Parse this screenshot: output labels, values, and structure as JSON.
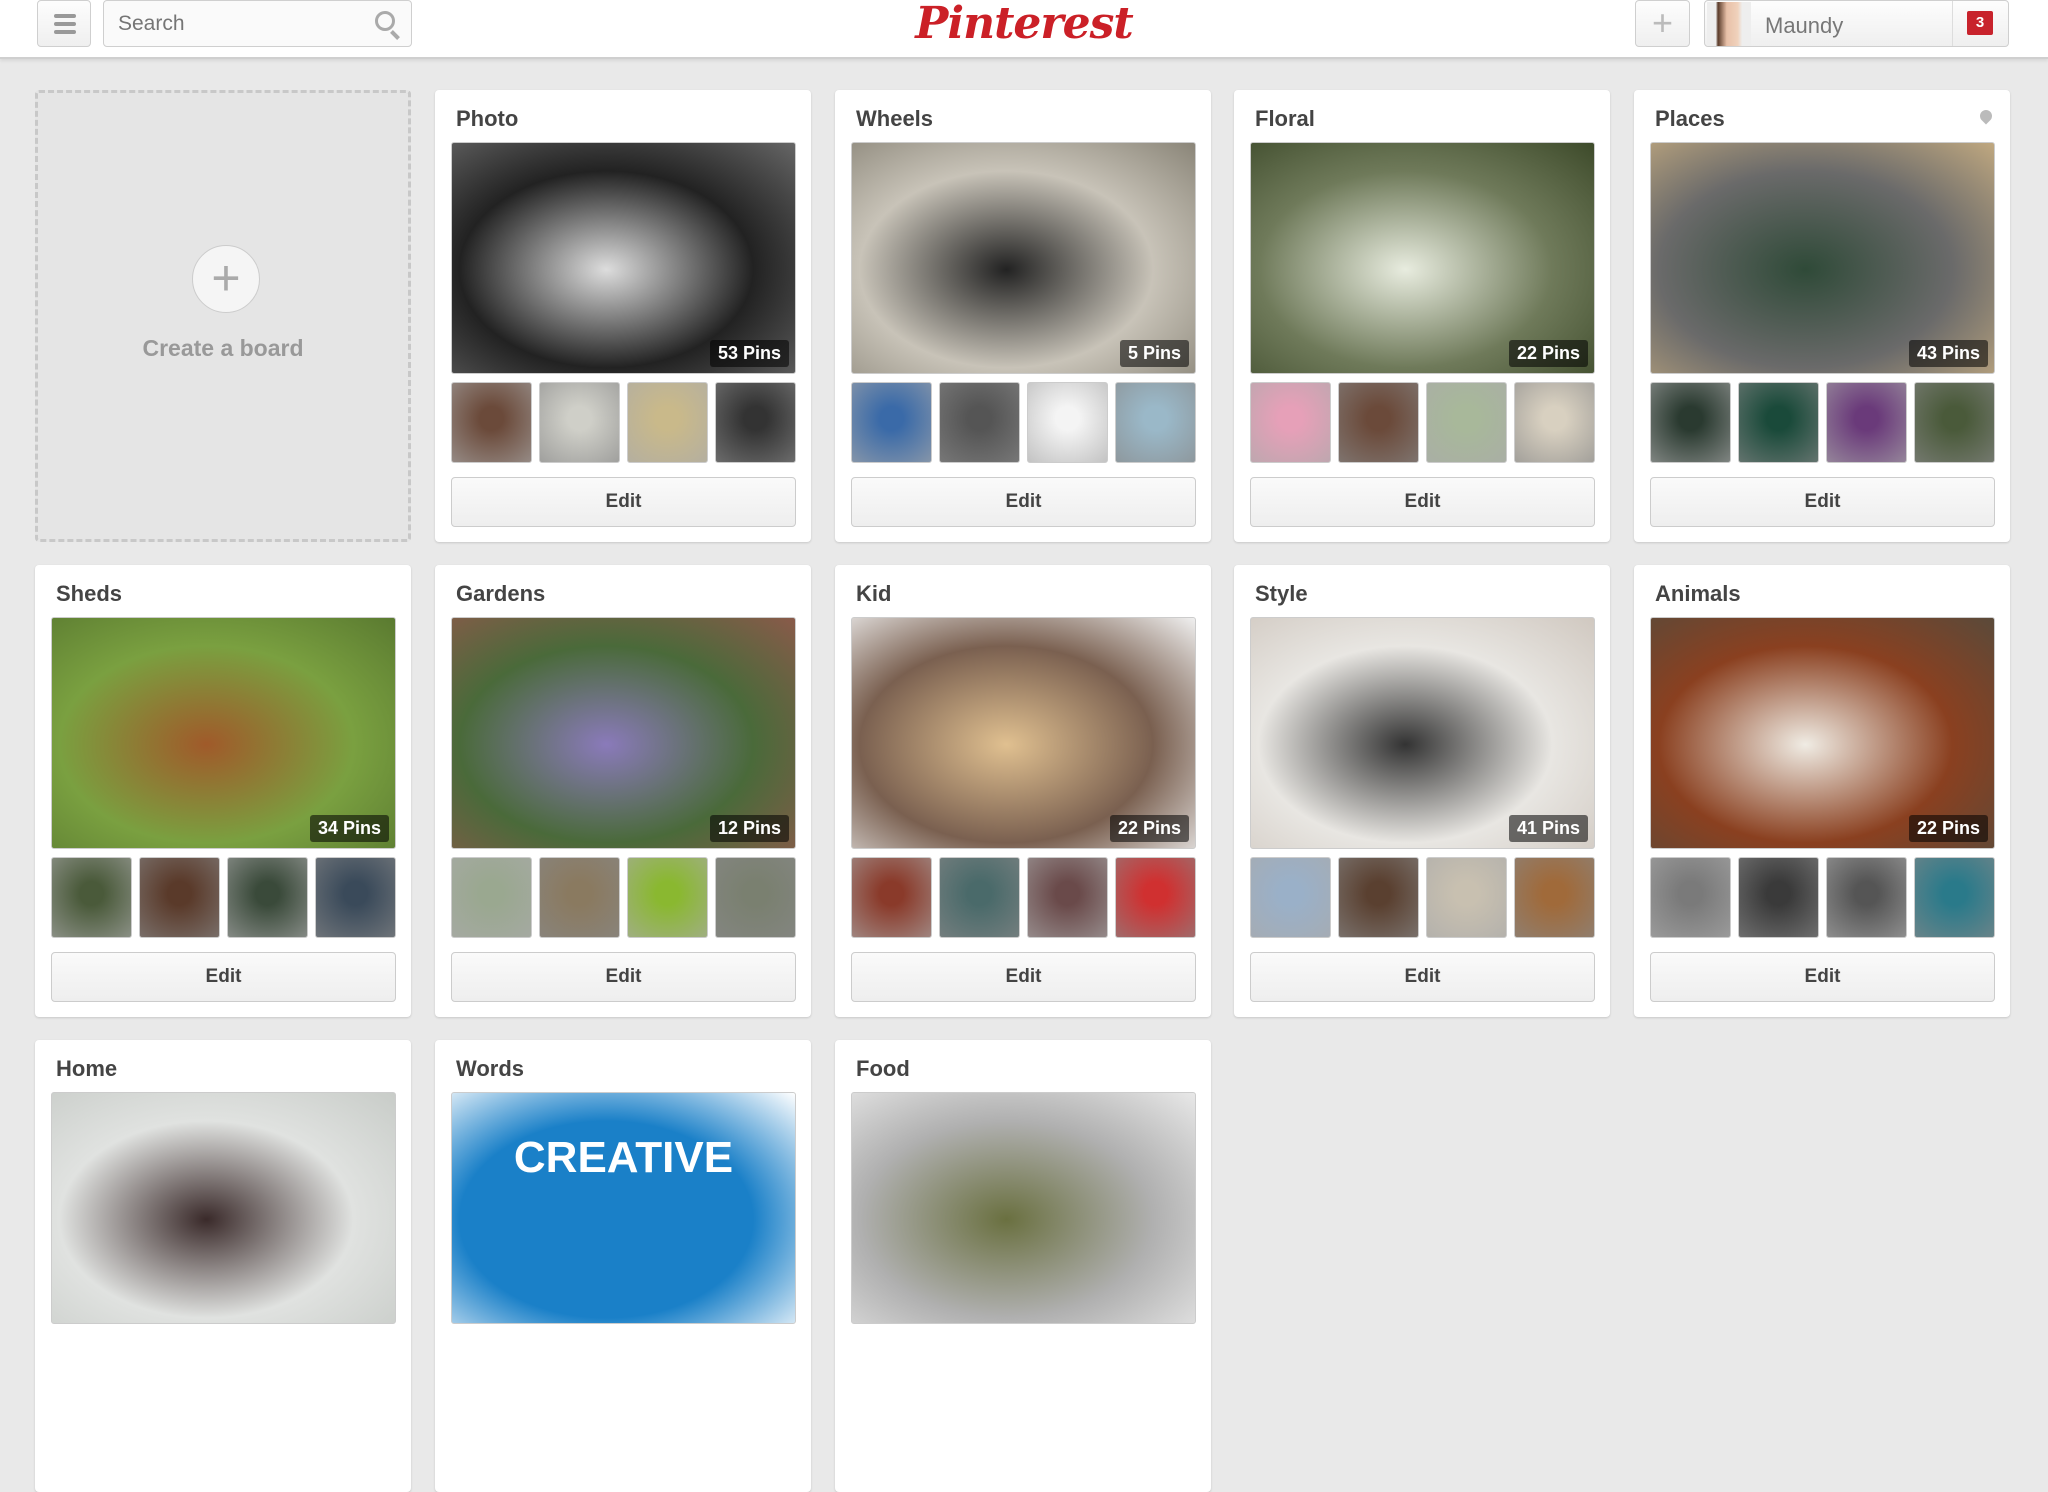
{
  "header": {
    "search_placeholder": "Search",
    "logo": "Pinterest",
    "user_name": "Maundy",
    "notification_count": "3",
    "brand_color": "#cb2027"
  },
  "create_board": {
    "label": "Create a board"
  },
  "edit_label": "Edit",
  "boards": [
    {
      "title": "Photo",
      "pins": "53 Pins",
      "cover": [
        "#222",
        "#ddd",
        "#666"
      ],
      "thumbs": [
        "#6b4a3a",
        "#cfcfc8",
        "#c9b98a",
        "#333"
      ]
    },
    {
      "title": "Wheels",
      "pins": "5 Pins",
      "cover": [
        "#c8c3b8",
        "#222",
        "#8a8578"
      ],
      "thumbs": [
        "#3a6aa8",
        "#555",
        "#f4f4f4",
        "#9ab8c8"
      ]
    },
    {
      "title": "Floral",
      "pins": "22 Pins",
      "cover": [
        "#6f7a5a",
        "#e8ecdf",
        "#3d4a2a"
      ],
      "thumbs": [
        "#e6a0b8",
        "#6b4a3a",
        "#a8b89a",
        "#d8d0c0"
      ]
    },
    {
      "title": "Places",
      "pins": "43 Pins",
      "cover": [
        "#6a6a6a",
        "#2f4a38",
        "#c0a880"
      ],
      "thumbs": [
        "#2a3a30",
        "#1a4a3a",
        "#6a3a7a",
        "#4a5a3a"
      ],
      "location": true
    },
    {
      "title": "Sheds",
      "pins": "34 Pins",
      "cover": [
        "#7aa040",
        "#a05a2a",
        "#5a7a30"
      ],
      "thumbs": [
        "#4a5a3a",
        "#5a3a2a",
        "#3a4a3a",
        "#3a4a5a"
      ]
    },
    {
      "title": "Gardens",
      "pins": "12 Pins",
      "cover": [
        "#4a6a3a",
        "#8a7aba",
        "#8a5a4a"
      ],
      "thumbs": [
        "#9aa890",
        "#8a7a60",
        "#8ab830",
        "#7a8070"
      ]
    },
    {
      "title": "Kid",
      "pins": "22 Pins",
      "cover": [
        "#7a6050",
        "#e0c090",
        "#f0f0f0"
      ],
      "thumbs": [
        "#8a3a2a",
        "#4a6a6a",
        "#6a4a4a",
        "#d03030"
      ]
    },
    {
      "title": "Style",
      "pins": "41 Pins",
      "cover": [
        "#e8e6e2",
        "#333",
        "#d0c8c0"
      ],
      "thumbs": [
        "#9ab0c8",
        "#5a4030",
        "#c8c0b0",
        "#a06a3a"
      ]
    },
    {
      "title": "Animals",
      "pins": "22 Pins",
      "cover": [
        "#8a4020",
        "#f0ece4",
        "#5a4a3a"
      ],
      "thumbs": [
        "#7a7a7a",
        "#3a3a3a",
        "#555",
        "#2a7a8a"
      ]
    },
    {
      "title": "Home",
      "cover": [
        "#e0e2e0",
        "#3a2a2a",
        "#c8ccc8"
      ]
    },
    {
      "title": "Words",
      "cover": [
        "#1a80c8",
        "#1a80c8",
        "#fff"
      ],
      "cover_text": "CREATIVE"
    },
    {
      "title": "Food",
      "cover": [
        "#b0b0b0",
        "#6a7040",
        "#e8e8e8"
      ]
    }
  ]
}
